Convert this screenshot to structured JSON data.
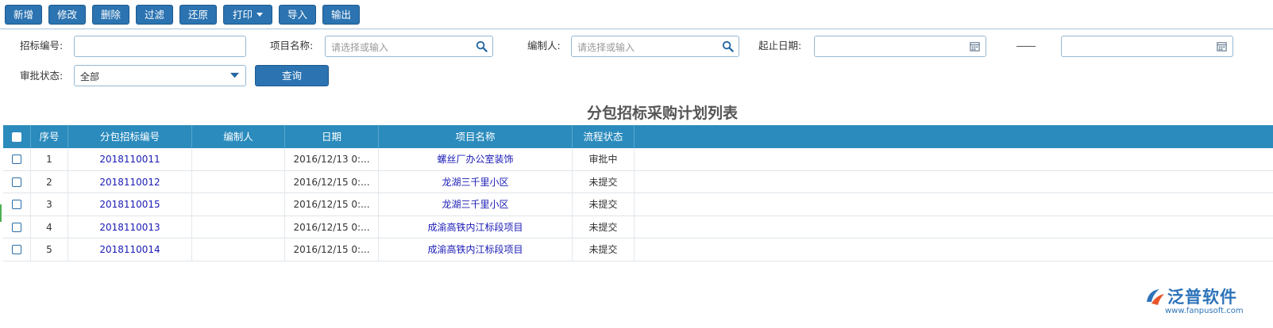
{
  "toolbar": {
    "add": "新增",
    "edit": "修改",
    "delete": "删除",
    "filter": "过滤",
    "restore": "还原",
    "print": "打印",
    "import": "导入",
    "export": "输出"
  },
  "filter": {
    "bid_no_label": "招标编号:",
    "bid_no_value": "",
    "project_label": "项目名称:",
    "project_placeholder": "请选择或输入",
    "editor_label": "编制人:",
    "editor_placeholder": "请选择或输入",
    "date_label": "起止日期:",
    "date_separator": "——",
    "status_label": "审批状态:",
    "status_value": "全部",
    "query": "查询"
  },
  "table": {
    "title": "分包招标采购计划列表",
    "columns": [
      "序号",
      "分包招标编号",
      "编制人",
      "日期",
      "项目名称",
      "流程状态"
    ],
    "rows": [
      {
        "no": "1",
        "code": "2018110011",
        "editor": "",
        "date": "2016/12/13 0:...",
        "project": "螺丝厂办公室装饰",
        "status": "审批中"
      },
      {
        "no": "2",
        "code": "2018110012",
        "editor": "",
        "date": "2016/12/15 0:...",
        "project": "龙湖三千里小区",
        "status": "未提交"
      },
      {
        "no": "3",
        "code": "2018110015",
        "editor": "",
        "date": "2016/12/15 0:...",
        "project": "龙湖三千里小区",
        "status": "未提交"
      },
      {
        "no": "4",
        "code": "2018110013",
        "editor": "",
        "date": "2016/12/15 0:...",
        "project": "成渝高铁内江标段项目",
        "status": "未提交"
      },
      {
        "no": "5",
        "code": "2018110014",
        "editor": "",
        "date": "2016/12/15 0:...",
        "project": "成渝高铁内江标段项目",
        "status": "未提交"
      }
    ]
  },
  "logo": {
    "brand": "泛普软件",
    "url": "www.fanpusoft.com"
  },
  "colors": {
    "primary_button": "#2b73b1",
    "table_header": "#2b8bbd",
    "link": "#1a1ab5"
  }
}
